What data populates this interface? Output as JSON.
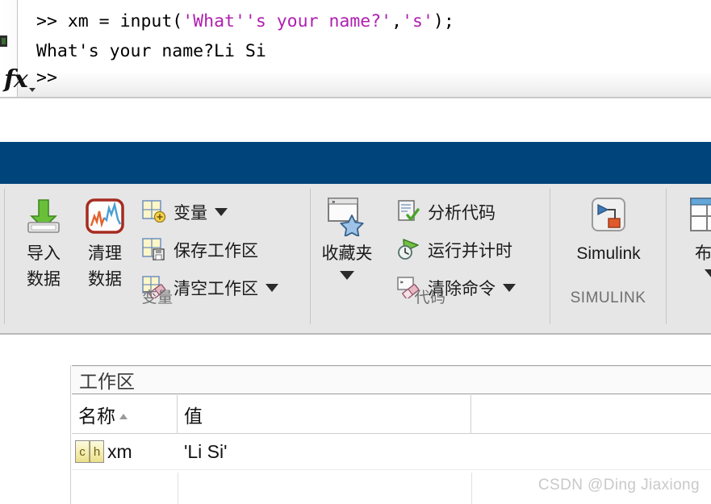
{
  "command_window": {
    "lines": [
      {
        "prompt": ">> ",
        "segments": [
          {
            "text": "xm = input(",
            "style": "plain"
          },
          {
            "text": "'What''s your name?'",
            "style": "string"
          },
          {
            "text": ",",
            "style": "plain"
          },
          {
            "text": "'s'",
            "style": "string"
          },
          {
            "text": ");",
            "style": "plain"
          }
        ]
      },
      {
        "prompt": "",
        "segments": [
          {
            "text": "What's your name?Li Si",
            "style": "plain"
          }
        ]
      }
    ],
    "line1_full": ">> xm = input('What''s your name?','s');",
    "line2_full": "What's your name?Li Si",
    "final_prompt": ">>",
    "fx_label": "fx"
  },
  "colors": {
    "band_blue": "#00447c",
    "string_purple": "#b020b0",
    "ribbon_bg": "#e6e6e6",
    "group_label": "#6f6f6f"
  },
  "ribbon": {
    "groups": [
      {
        "label": "变量",
        "big_buttons": [
          {
            "label_line1": "导入",
            "label_line2": "数据",
            "icon": "import-data-icon"
          },
          {
            "label_line1": "清理",
            "label_line2": "数据",
            "icon": "clean-data-icon"
          }
        ],
        "small_items": [
          {
            "label": "变量",
            "icon": "new-variable-icon",
            "has_caret": true
          },
          {
            "label": "保存工作区",
            "icon": "save-workspace-icon",
            "has_caret": false
          },
          {
            "label": "清空工作区",
            "icon": "clear-workspace-icon",
            "has_caret": true
          }
        ]
      },
      {
        "label": "代码",
        "big_buttons": [
          {
            "label_line1": "收藏夹",
            "label_line2": "",
            "icon": "favorites-icon",
            "has_caret": true
          }
        ],
        "small_items": [
          {
            "label": "分析代码",
            "icon": "analyze-code-icon",
            "has_caret": false
          },
          {
            "label": "运行并计时",
            "icon": "run-and-time-icon",
            "has_caret": false
          },
          {
            "label": "清除命令",
            "icon": "clear-commands-icon",
            "has_caret": true
          }
        ]
      },
      {
        "label": "SIMULINK",
        "big_buttons": [
          {
            "label_line1": "Simulink",
            "label_line2": "",
            "icon": "simulink-icon"
          }
        ],
        "small_items": []
      },
      {
        "label": "",
        "big_buttons": [
          {
            "label_line1": "布局",
            "label_line2": "",
            "icon": "layout-icon",
            "has_caret": true
          }
        ],
        "small_items": []
      }
    ]
  },
  "workspace": {
    "title": "工作区",
    "columns": [
      "名称",
      "值"
    ],
    "sorted_column": "名称",
    "sort_direction": "ascending",
    "rows": [
      {
        "name": "xm",
        "value": "'Li Si'",
        "type_icon": "char-type-icon",
        "type_icon_text": [
          "c",
          "h"
        ]
      }
    ],
    "expand_button": "expand-collapse-button"
  },
  "watermark": "CSDN @Ding Jiaxiong"
}
